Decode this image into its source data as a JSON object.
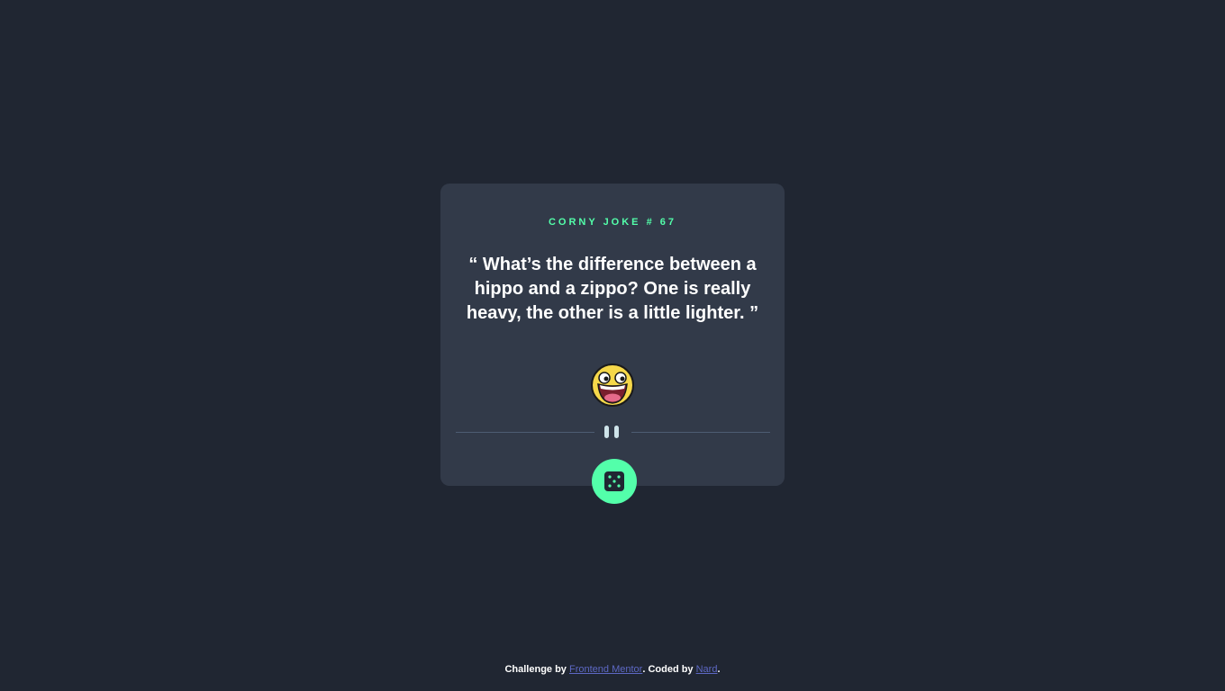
{
  "card": {
    "joke_id": "CORNY JOKE # 67",
    "quote": "“ What’s the difference between a hippo and a zippo? One is really heavy, the other is a little lighter. ”",
    "emoji_icon": "laughing-face-icon",
    "divider_icon": "pause-icon",
    "dice_button_icon": "dice-icon"
  },
  "footer": {
    "prefix": "Challenge by ",
    "link1": "Frontend Mentor",
    "middle": ". Coded by ",
    "link2": "Nard",
    "suffix": "."
  },
  "colors": {
    "background": "#202632",
    "card": "#323a49",
    "accent": "#53ffaa",
    "text": "#ffffff",
    "link": "#5d68c4",
    "divider": "#4e5d73"
  }
}
